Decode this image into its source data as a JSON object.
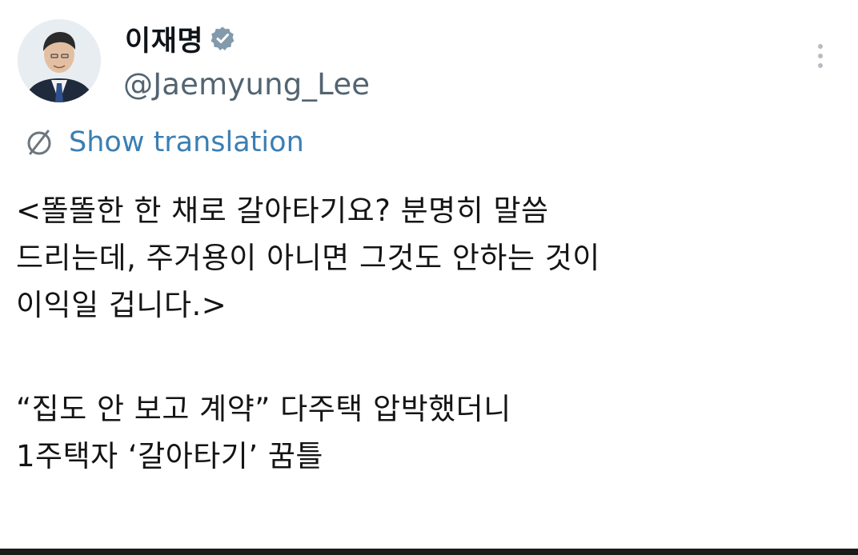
{
  "author": {
    "display_name": "이재명",
    "handle": "@Jaemyung_Lee",
    "verified": true,
    "verified_badge_color": "#829aab"
  },
  "actions": {
    "more_icon": "more-vertical-icon"
  },
  "translation": {
    "icon": "globe-icon",
    "label": "Show translation",
    "color": "#3a7fb3"
  },
  "tweet": {
    "lines": [
      "<똘똘한 한 채로 갈아타기요? 분명히 말씀",
      "드리는데, 주거용이 아니면 그것도 안하는 것이",
      "이익일 겁니다.>"
    ],
    "headline_lines": [
      "“집도 안 보고 계약” 다주택 압박했더니",
      "1주택자 ‘갈아타기’ 꿈틀"
    ]
  },
  "colors": {
    "text": "#141414",
    "secondary_text": "#536471",
    "background": "#ffffff"
  }
}
